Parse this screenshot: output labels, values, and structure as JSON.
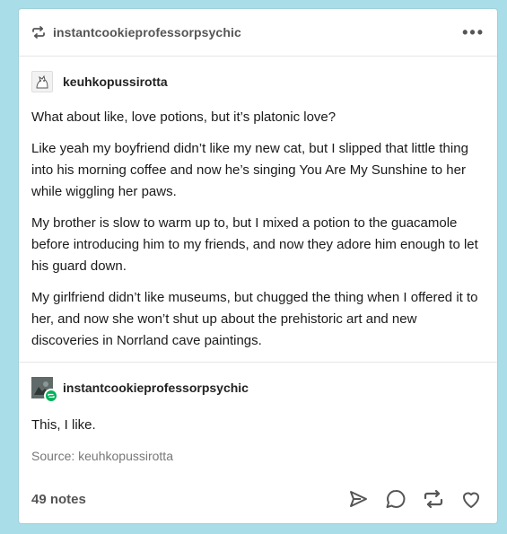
{
  "header": {
    "reblogger": "instantcookieprofessorpsychic",
    "more_label": "•••"
  },
  "original_post": {
    "author": "keuhkopussirotta",
    "paragraphs": [
      "What about like, love potions, but it’s platonic love?",
      " Like yeah my boyfriend didn’t like my new cat, but I slipped that little thing into his morning coffee and now he’s singing You Are My Sunshine to her while wiggling her paws.",
      " My brother is slow to warm up to, but I mixed a potion to the guacamole before introducing him to my friends, and now they adore him enough to let his guard down.",
      " My girlfriend didn’t like museums, but chugged the thing when I offered it to her, and now she won’t shut up about the prehistoric art and new discoveries in Norrland cave paintings."
    ]
  },
  "reblog_post": {
    "author": "instantcookieprofessorpsychic",
    "text": "This, I like.",
    "source": "Source: keuhkopussirotta"
  },
  "footer": {
    "notes": "49 notes",
    "actions": [
      "share-icon",
      "reply-icon",
      "reblog-icon",
      "like-icon"
    ]
  },
  "colors": {
    "background": "#a9dde8",
    "card": "#ffffff",
    "reblog_badge": "#00b259"
  }
}
